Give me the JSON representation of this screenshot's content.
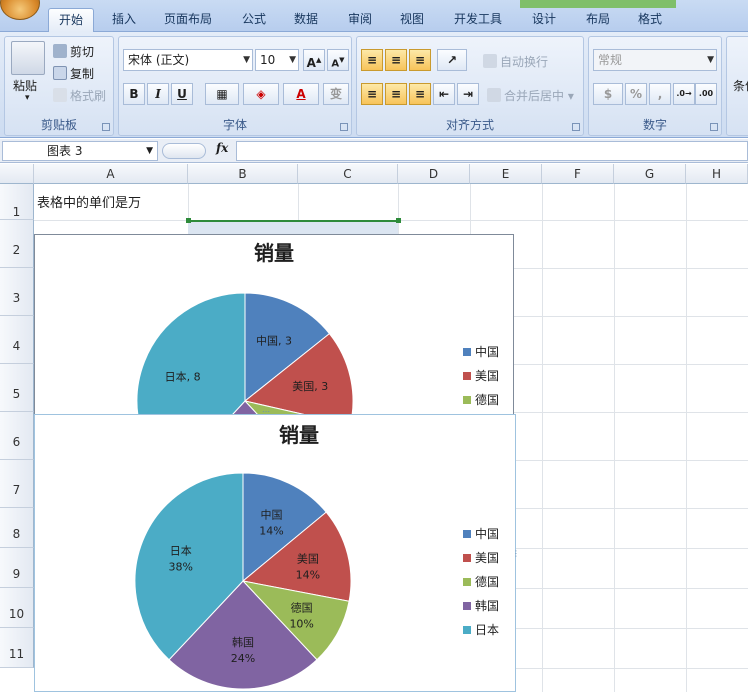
{
  "ribbon": {
    "tabs": [
      "开始",
      "插入",
      "页面布局",
      "公式",
      "数据",
      "审阅",
      "视图",
      "开发工具",
      "设计",
      "布局",
      "格式"
    ],
    "active_tab": "开始",
    "clipboard": {
      "paste": "粘贴",
      "cut": "剪切",
      "copy": "复制",
      "format_painter": "格式刷",
      "label": "剪贴板"
    },
    "font": {
      "name": "宋体 (正文)",
      "size": "10",
      "label": "字体"
    },
    "alignment": {
      "wrap": "自动换行",
      "merge": "合并后居中",
      "label": "对齐方式"
    },
    "number": {
      "format": "常规",
      "percent": "%",
      "comma": ",",
      "label": "数字"
    },
    "styles_partial": "条件"
  },
  "formula_bar": {
    "name_box": "图表 3",
    "fx": "fx",
    "content": ""
  },
  "grid": {
    "columns": [
      "A",
      "B",
      "C",
      "D",
      "E",
      "F",
      "G",
      "H"
    ],
    "rows": [
      "1",
      "2",
      "3",
      "4",
      "5",
      "6",
      "7",
      "8",
      "9",
      "10",
      "11"
    ],
    "a1_text": "表格中的单们是万"
  },
  "chart1": {
    "title": "销量",
    "legend": [
      "中国",
      "美国",
      "德国"
    ],
    "data_labels": [
      "中国, 3",
      "美国, 3",
      "日本, 8"
    ]
  },
  "chart2": {
    "title": "销量",
    "legend": [
      "中国",
      "美国",
      "德国",
      "韩国",
      "日本"
    ],
    "data_labels": [
      {
        "name": "中国",
        "pct": "14%"
      },
      {
        "name": "美国",
        "pct": "14%"
      },
      {
        "name": "德国",
        "pct": "10%"
      },
      {
        "name": "韩国",
        "pct": "24%"
      },
      {
        "name": "日本",
        "pct": "38%"
      }
    ]
  },
  "chart_data": [
    {
      "type": "pie",
      "title": "销量",
      "categories": [
        "中国",
        "美国",
        "德国",
        "韩国",
        "日本"
      ],
      "values": [
        3,
        3,
        2,
        5,
        8
      ],
      "legend_visible": [
        "中国",
        "美国",
        "德国"
      ]
    },
    {
      "type": "pie",
      "title": "销量",
      "categories": [
        "中国",
        "美国",
        "德国",
        "韩国",
        "日本"
      ],
      "values": [
        14,
        14,
        10,
        24,
        38
      ],
      "legend": "right"
    }
  ],
  "colors": {
    "china": "#4f81bd",
    "usa": "#c0504d",
    "germany": "#9bbb59",
    "korea": "#8064a2",
    "japan": "#4bacc6"
  }
}
